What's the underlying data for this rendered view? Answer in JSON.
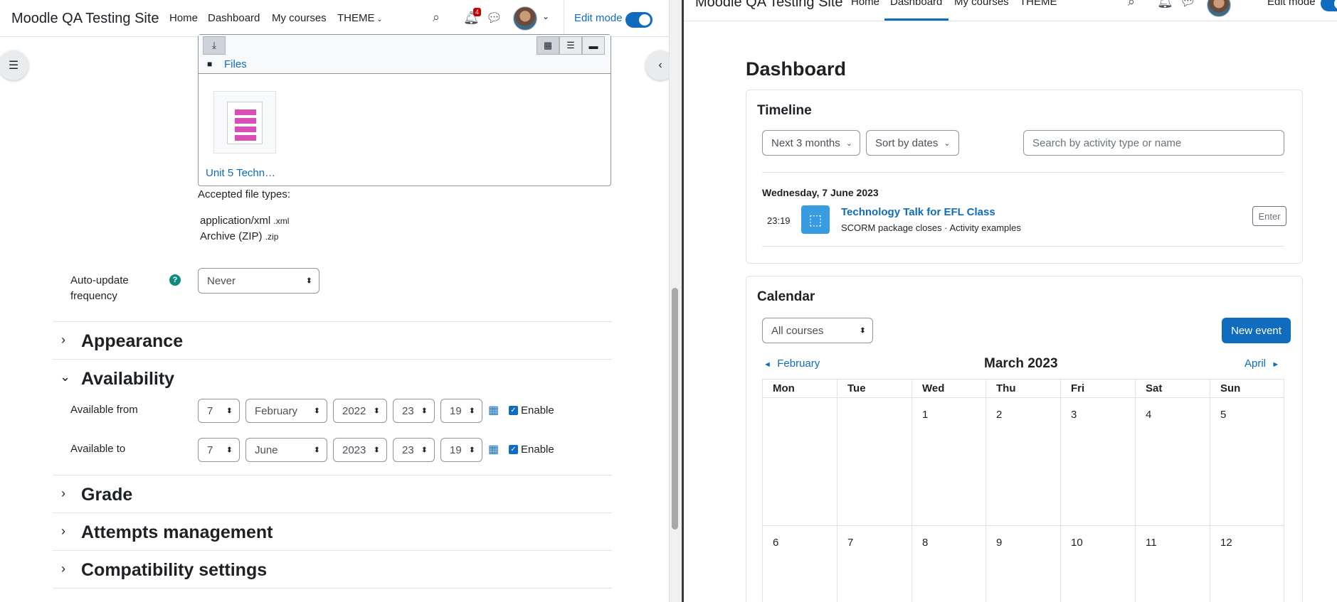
{
  "left": {
    "brand": "Moodle QA Testing Site",
    "nav": [
      "Home",
      "Dashboard",
      "My courses",
      "THEME"
    ],
    "notifications_count": "4",
    "edit_mode_label": "Edit mode",
    "files_label": "Files",
    "file_name": "Unit 5 Techn…",
    "accepted_label": "Accepted file types:",
    "accepted_types": [
      {
        "name": "application/xml",
        "ext": ".xml"
      },
      {
        "name": "Archive (ZIP)",
        "ext": ".zip"
      }
    ],
    "auto_update": {
      "label_line1": "Auto-update",
      "label_line2": "frequency",
      "value": "Never"
    },
    "sections": {
      "appearance": "Appearance",
      "availability": "Availability",
      "grade": "Grade",
      "attempts": "Attempts management",
      "compat": "Compatibility settings"
    },
    "available_from": {
      "label": "Available from",
      "day": "7",
      "month": "February",
      "year": "2022",
      "hour": "23",
      "minute": "19",
      "enable": "Enable"
    },
    "available_to": {
      "label": "Available to",
      "day": "7",
      "month": "June",
      "year": "2023",
      "hour": "23",
      "minute": "19",
      "enable": "Enable"
    }
  },
  "right": {
    "brand": "Moodle QA Testing Site",
    "nav": [
      "Home",
      "Dashboard",
      "My courses",
      "THEME"
    ],
    "edit_mode_label": "Edit mode",
    "page_title": "Dashboard",
    "timeline": {
      "title": "Timeline",
      "range": "Next 3 months",
      "sort": "Sort by dates",
      "search_placeholder": "Search by activity type or name",
      "date": "Wednesday, 7 June 2023",
      "time": "23:19",
      "event_title": "Technology Talk for EFL Class",
      "event_sub": "SCORM package closes · Activity examples",
      "enter": "Enter"
    },
    "calendar": {
      "title": "Calendar",
      "filter": "All courses",
      "new_event": "New event",
      "prev": "February",
      "month": "March 2023",
      "next": "April",
      "days": [
        "Mon",
        "Tue",
        "Wed",
        "Thu",
        "Fri",
        "Sat",
        "Sun"
      ],
      "week1": [
        "",
        "",
        "1",
        "2",
        "3",
        "4",
        "5"
      ],
      "week2": [
        "6",
        "7",
        "8",
        "9",
        "10",
        "11",
        "12"
      ]
    }
  },
  "colors": {
    "accent": "#0f6cbf",
    "help": "#0f8a7e",
    "badge": "#c90000",
    "activity": "#399be2"
  }
}
